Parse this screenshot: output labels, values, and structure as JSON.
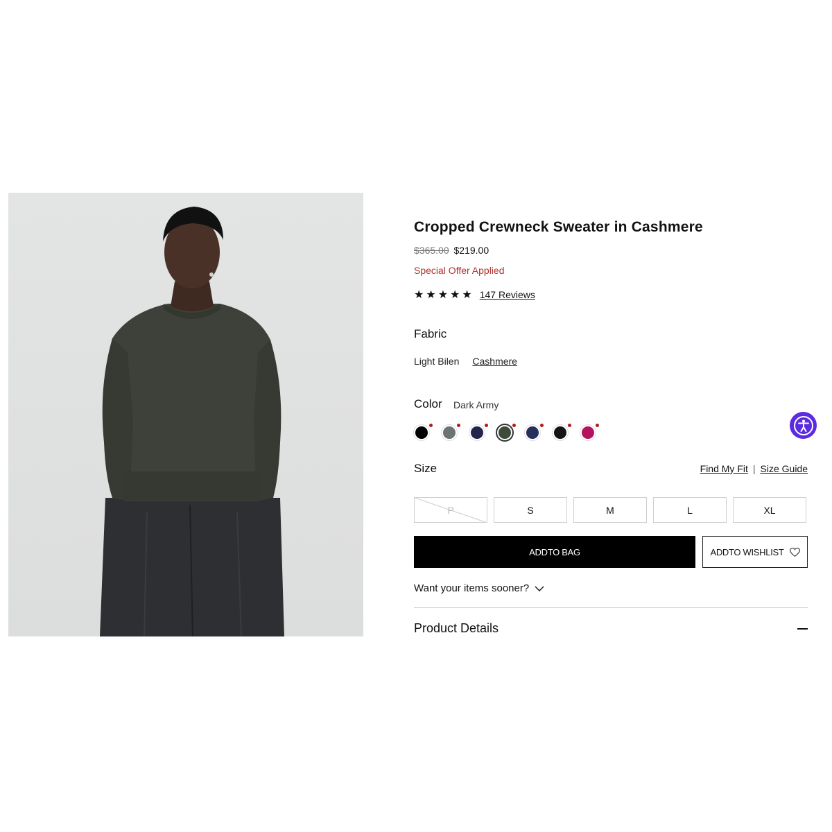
{
  "product": {
    "title": "Cropped Crewneck Sweater in Cashmere",
    "price_original": "$365.00",
    "price_sale": "$219.00",
    "offer_text": "Special Offer Applied",
    "stars": "★★★★★",
    "rating_value": 5,
    "reviews_label": "147 Reviews"
  },
  "fabric": {
    "label": "Fabric",
    "options": [
      "Light Bilen",
      "Cashmere"
    ],
    "selected": "Cashmere"
  },
  "color": {
    "label": "Color",
    "selected_name": "Dark Army",
    "swatches": [
      "#000000",
      "#6d7373",
      "#24254d",
      "#3d4a3a",
      "#25305a",
      "#151515",
      "#b4125f"
    ],
    "selected_index": 3
  },
  "size": {
    "label": "Size",
    "find_fit": "Find My Fit",
    "separator": "|",
    "size_guide": "Size Guide",
    "options": [
      "P",
      "S",
      "M",
      "L",
      "XL"
    ]
  },
  "actions": {
    "add_to_bag": "ADDTO BAG",
    "add_to_wishlist": "ADDTO WISHLIST"
  },
  "shipping": {
    "sooner_text": "Want your items sooner?"
  },
  "accordion": {
    "product_details": "Product Details"
  },
  "colors": {
    "sale": "#b0322e",
    "accessibility": "#5b2be0"
  },
  "icons": [
    "heart-icon",
    "chevron-down-icon",
    "minus-icon",
    "accessibility-icon",
    "star-icon"
  ]
}
